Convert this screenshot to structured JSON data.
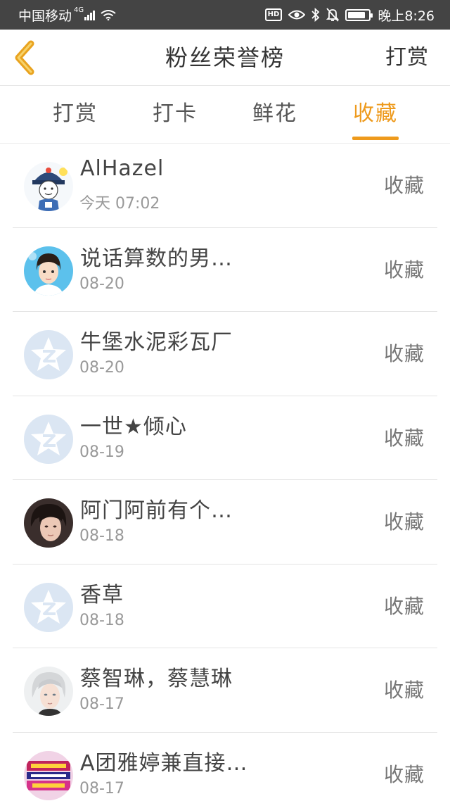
{
  "status_bar": {
    "carrier": "中国移动",
    "network": "4G",
    "time": "晚上8:26",
    "hd_label": "HD",
    "battery_level": 0.85
  },
  "header": {
    "title": "粉丝荣誉榜",
    "right_action": "打赏"
  },
  "tabs": [
    {
      "label": "打赏",
      "active": false
    },
    {
      "label": "打卡",
      "active": false
    },
    {
      "label": "鲜花",
      "active": false
    },
    {
      "label": "收藏",
      "active": true
    }
  ],
  "accent_color": "#ee9a1c",
  "list": [
    {
      "name": "AlHazel",
      "date": "今天 07:02",
      "action": "收藏",
      "avatar": "cartoon-official-avatar"
    },
    {
      "name": "说话算数的男…",
      "date": "08-20",
      "action": "收藏",
      "avatar": "anime-boy-avatar"
    },
    {
      "name": "牛堡水泥彩瓦厂",
      "date": "08-20",
      "action": "收藏",
      "avatar": "default-star-avatar"
    },
    {
      "name": "一世★倾心",
      "date": "08-19",
      "action": "收藏",
      "avatar": "default-star-avatar"
    },
    {
      "name": "阿门阿前有个…",
      "date": "08-18",
      "action": "收藏",
      "avatar": "photo-portrait-avatar"
    },
    {
      "name": "香草",
      "date": "08-18",
      "action": "收藏",
      "avatar": "default-star-avatar"
    },
    {
      "name": "蔡智琳，蔡慧琳",
      "date": "08-17",
      "action": "收藏",
      "avatar": "silver-hair-avatar"
    },
    {
      "name": "A团雅婷兼直接…",
      "date": "08-17",
      "action": "收藏",
      "avatar": "ad-banner-avatar"
    }
  ]
}
